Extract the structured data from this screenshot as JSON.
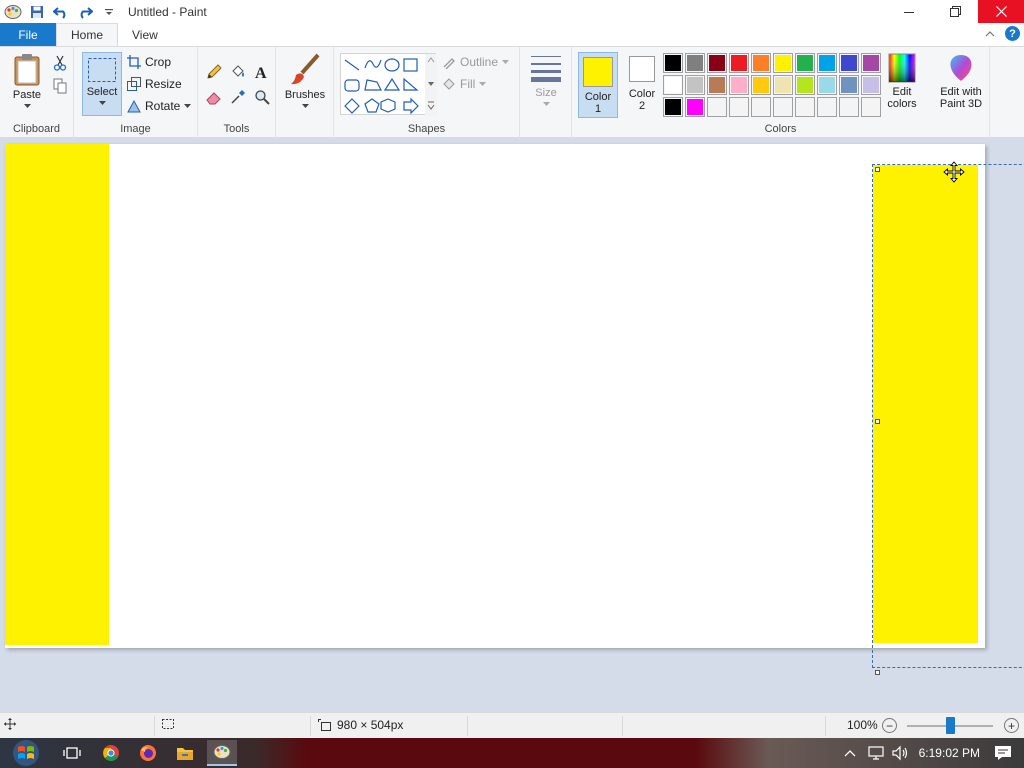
{
  "window": {
    "title": "Untitled - Paint"
  },
  "tabs": {
    "file": "File",
    "home": "Home",
    "view": "View",
    "help": "?"
  },
  "ribbon": {
    "clipboard": {
      "label": "Clipboard",
      "paste": "Paste"
    },
    "image": {
      "label": "Image",
      "select": "Select",
      "crop": "Crop",
      "resize": "Resize",
      "rotate": "Rotate"
    },
    "tools": {
      "label": "Tools"
    },
    "brushes": {
      "label": "Brushes"
    },
    "shapes": {
      "label": "Shapes",
      "outline": "Outline",
      "fill": "Fill"
    },
    "size": {
      "label": "Size"
    },
    "colors": {
      "label": "Colors",
      "color1_line1": "Color",
      "color1_line2": "1",
      "color2_line1": "Color",
      "color2_line2": "2",
      "edit_colors_line1": "Edit",
      "edit_colors_line2": "colors",
      "paint3d_line1": "Edit with",
      "paint3d_line2": "Paint 3D",
      "color1_value": "#fff200",
      "color2_value": "#ffffff",
      "palette": [
        "#000000",
        "#7f7f7f",
        "#880015",
        "#ed1c24",
        "#ff7f27",
        "#fff200",
        "#22b14c",
        "#00a2e8",
        "#3f48cc",
        "#a349a4",
        "#ffffff",
        "#c3c3c3",
        "#b97a57",
        "#ffaec9",
        "#ffc90e",
        "#efe4b0",
        "#b5e61d",
        "#99d9ea",
        "#7092be",
        "#c8bfe7",
        "#000000",
        "#ff00ff",
        "#f4f4f4",
        "#f4f4f4",
        "#f4f4f4",
        "#f4f4f4",
        "#f4f4f4",
        "#f4f4f4",
        "#f4f4f4",
        "#f4f4f4"
      ]
    }
  },
  "canvas": {
    "fill_color": "#fff200"
  },
  "status": {
    "canvas_size": "980 × 504px",
    "zoom": "100%",
    "zoom_minus": "−",
    "zoom_plus": "+"
  },
  "taskbar": {
    "time": "6:19:02 PM"
  }
}
